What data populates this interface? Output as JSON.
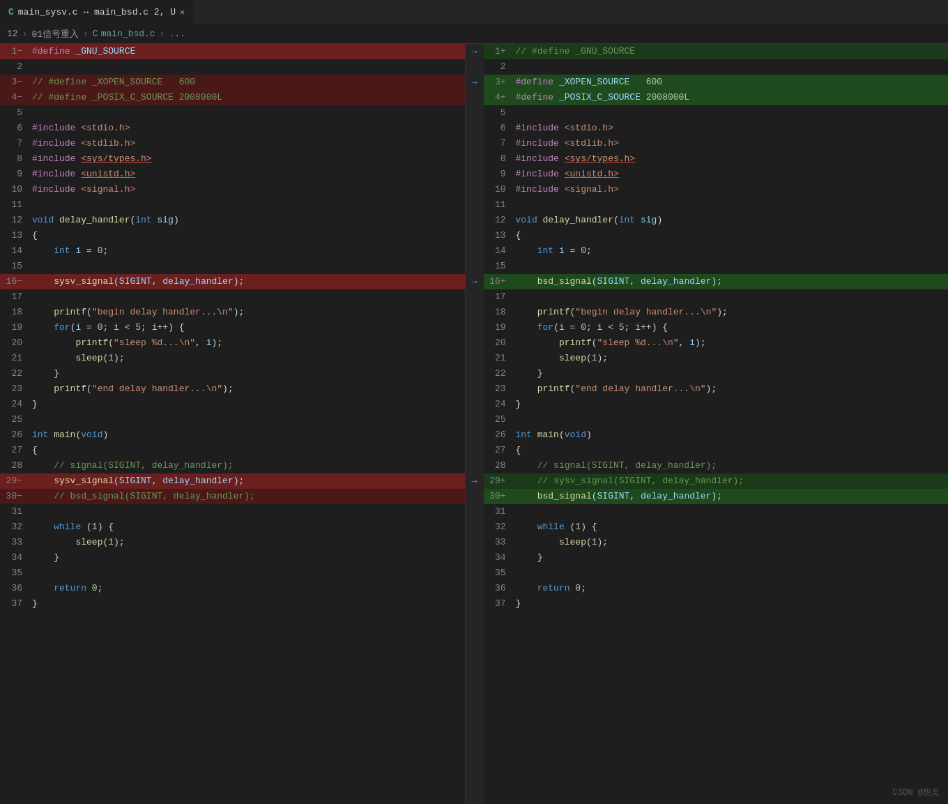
{
  "tab": {
    "c_label": "C",
    "title": "main_sysv.c ↔ main_bsd.c 2, U",
    "close": "✕"
  },
  "breadcrumb": {
    "num": "12",
    "arrow": "›",
    "folder": "01信号重入",
    "sep1": "›",
    "c_label": "C",
    "file": "main_bsd.c",
    "sep2": "›",
    "dots": "..."
  },
  "watermark": "CSDN @想吴"
}
